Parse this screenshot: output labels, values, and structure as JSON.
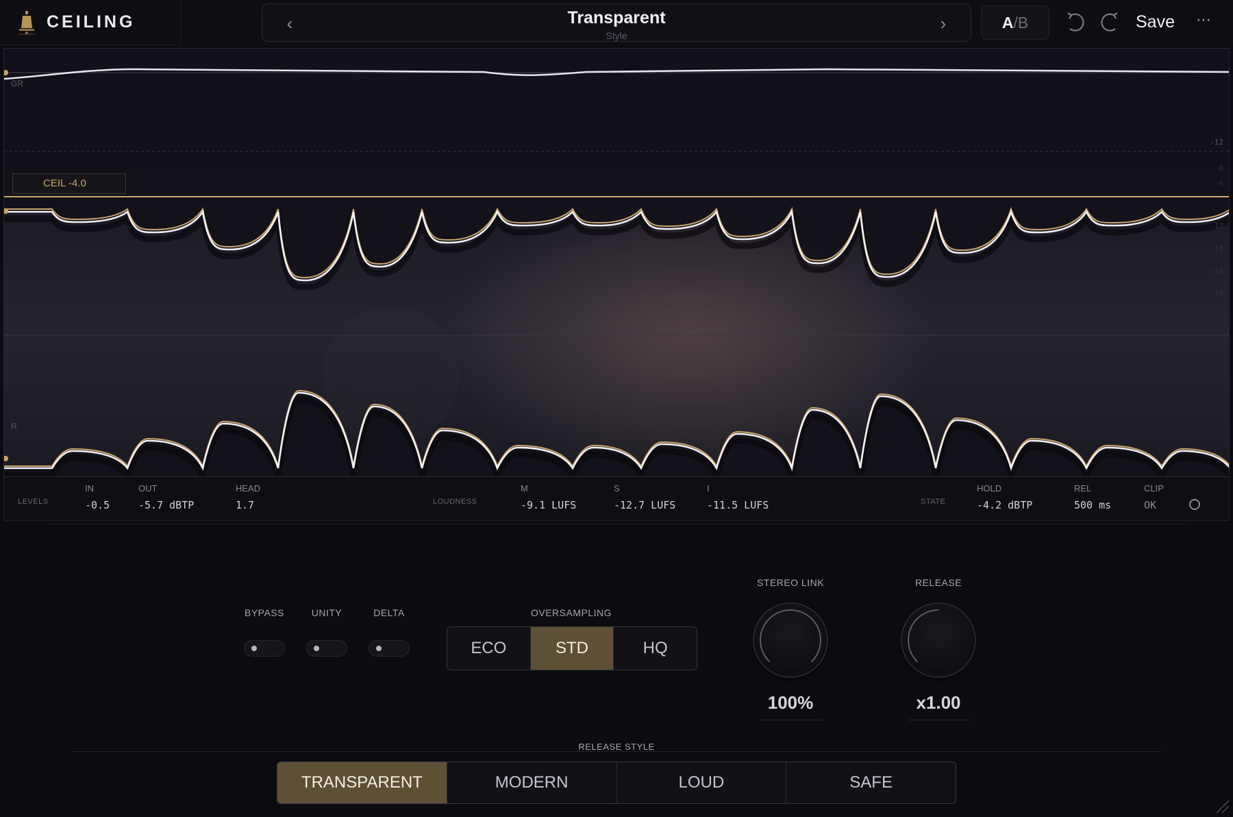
{
  "app": {
    "name": "CEILING"
  },
  "preset": {
    "name": "Transparent",
    "subtitle": "Style",
    "prev": "‹",
    "next": "›"
  },
  "toolbar": {
    "ab_a": "A",
    "ab_sep": "/",
    "ab_b": "B",
    "save_label": "Save",
    "more_label": "⋯"
  },
  "display": {
    "gr_label": "GR",
    "r_label": "R",
    "ceiling_tag": "CEIL -4.0",
    "scale": [
      "-12",
      "0",
      "-6",
      "-12",
      "-18",
      "-24",
      "-30"
    ],
    "colors": {
      "waveform": "#f2f0f4",
      "ceiling": "#c9a56b",
      "shadow": "#0a090d"
    }
  },
  "levels": {
    "levels_label": "LEVELS",
    "in": {
      "label": "IN",
      "value": "-0.5"
    },
    "out": {
      "label": "OUT",
      "value": "-5.7 dBTP"
    },
    "head": {
      "label": "HEAD",
      "value": "1.7"
    },
    "loudness_label": "LOUDNESS",
    "m": {
      "label": "M",
      "value": "-9.1 LUFS"
    },
    "s": {
      "label": "S",
      "value": "-12.7 LUFS"
    },
    "i": {
      "label": "I",
      "value": "-11.5 LUFS"
    },
    "state_label": "STATE",
    "hold": {
      "label": "HOLD",
      "value": "-4.2 dBTP"
    },
    "rel": {
      "label": "REL",
      "value": "500 ms"
    },
    "clip": {
      "label": "CLIP",
      "value": "OK"
    }
  },
  "controls": {
    "bypass": {
      "label": "BYPASS",
      "on": false
    },
    "unity": {
      "label": "UNITY",
      "on": false
    },
    "delta": {
      "label": "DELTA",
      "on": false
    },
    "oversampling": {
      "label": "OVERSAMPLING",
      "options": [
        "ECO",
        "STD",
        "HQ"
      ],
      "selected": "STD"
    },
    "stereo_link": {
      "label": "STEREO LINK",
      "value": "100%",
      "level": 1.0
    },
    "release": {
      "label": "RELEASE",
      "value": "x1.00",
      "level": 0.5
    },
    "release_style": {
      "label": "RELEASE STYLE",
      "options": [
        "TRANSPARENT",
        "MODERN",
        "LOUD",
        "SAFE"
      ],
      "selected": "TRANSPARENT"
    },
    "accent_color": "#5e4f35"
  }
}
